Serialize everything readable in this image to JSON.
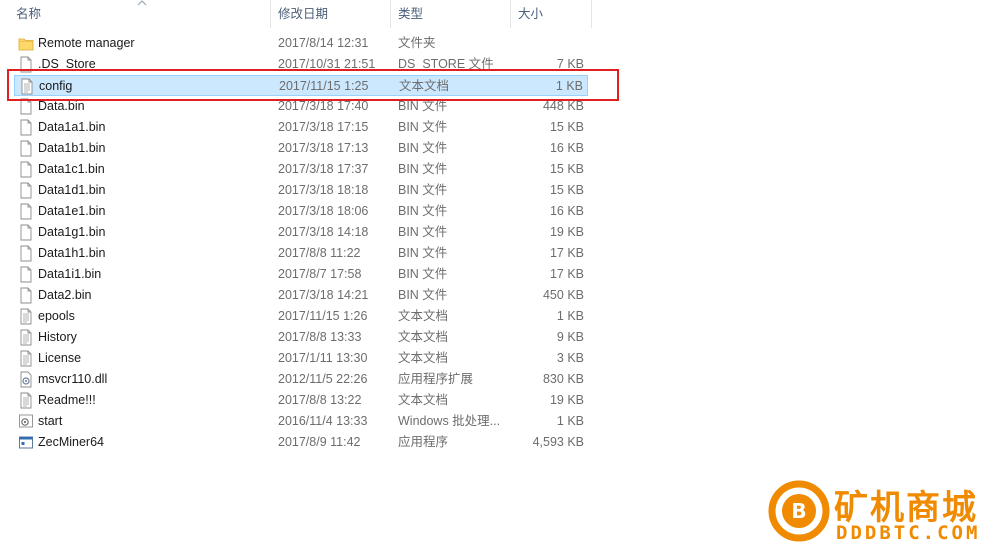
{
  "columns": {
    "name": "名称",
    "date": "修改日期",
    "type": "类型",
    "size": "大小"
  },
  "files": [
    {
      "name": "Remote manager",
      "date": "2017/8/14 12:31",
      "type": "文件夹",
      "size": "",
      "icon": "folder-icon"
    },
    {
      "name": ".DS_Store",
      "date": "2017/10/31 21:51",
      "type": "DS_STORE 文件",
      "size": "7 KB",
      "icon": "file-icon"
    },
    {
      "name": "config",
      "date": "2017/11/15 1:25",
      "type": "文本文档",
      "size": "1 KB",
      "icon": "text-file-icon"
    },
    {
      "name": "Data.bin",
      "date": "2017/3/18 17:40",
      "type": "BIN 文件",
      "size": "448 KB",
      "icon": "file-icon"
    },
    {
      "name": "Data1a1.bin",
      "date": "2017/3/18 17:15",
      "type": "BIN 文件",
      "size": "15 KB",
      "icon": "file-icon"
    },
    {
      "name": "Data1b1.bin",
      "date": "2017/3/18 17:13",
      "type": "BIN 文件",
      "size": "16 KB",
      "icon": "file-icon"
    },
    {
      "name": "Data1c1.bin",
      "date": "2017/3/18 17:37",
      "type": "BIN 文件",
      "size": "15 KB",
      "icon": "file-icon"
    },
    {
      "name": "Data1d1.bin",
      "date": "2017/3/18 18:18",
      "type": "BIN 文件",
      "size": "15 KB",
      "icon": "file-icon"
    },
    {
      "name": "Data1e1.bin",
      "date": "2017/3/18 18:06",
      "type": "BIN 文件",
      "size": "16 KB",
      "icon": "file-icon"
    },
    {
      "name": "Data1g1.bin",
      "date": "2017/3/18 14:18",
      "type": "BIN 文件",
      "size": "19 KB",
      "icon": "file-icon"
    },
    {
      "name": "Data1h1.bin",
      "date": "2017/8/8 11:22",
      "type": "BIN 文件",
      "size": "17 KB",
      "icon": "file-icon"
    },
    {
      "name": "Data1i1.bin",
      "date": "2017/8/7 17:58",
      "type": "BIN 文件",
      "size": "17 KB",
      "icon": "file-icon"
    },
    {
      "name": "Data2.bin",
      "date": "2017/3/18 14:21",
      "type": "BIN 文件",
      "size": "450 KB",
      "icon": "file-icon"
    },
    {
      "name": "epools",
      "date": "2017/11/15 1:26",
      "type": "文本文档",
      "size": "1 KB",
      "icon": "text-file-icon"
    },
    {
      "name": "History",
      "date": "2017/8/8 13:33",
      "type": "文本文档",
      "size": "9 KB",
      "icon": "text-file-icon"
    },
    {
      "name": "License",
      "date": "2017/1/11 13:30",
      "type": "文本文档",
      "size": "3 KB",
      "icon": "text-file-icon"
    },
    {
      "name": "msvcr110.dll",
      "date": "2012/11/5 22:26",
      "type": "应用程序扩展",
      "size": "830 KB",
      "icon": "dll-icon"
    },
    {
      "name": "Readme!!!",
      "date": "2017/8/8 13:22",
      "type": "文本文档",
      "size": "19 KB",
      "icon": "text-file-icon"
    },
    {
      "name": "start",
      "date": "2016/11/4 13:33",
      "type": "Windows 批处理...",
      "size": "1 KB",
      "icon": "batch-file-icon"
    },
    {
      "name": "ZecMiner64",
      "date": "2017/8/9 11:42",
      "type": "应用程序",
      "size": "4,593 KB",
      "icon": "exe-icon"
    }
  ],
  "selected_index": 2,
  "watermark": {
    "title": "矿机商城",
    "url": "DDDBTC.COM",
    "logo_letter": "B"
  },
  "colors": {
    "selection": "#cce8ff",
    "highlight": "#e02020",
    "watermark": "#f08a00"
  }
}
